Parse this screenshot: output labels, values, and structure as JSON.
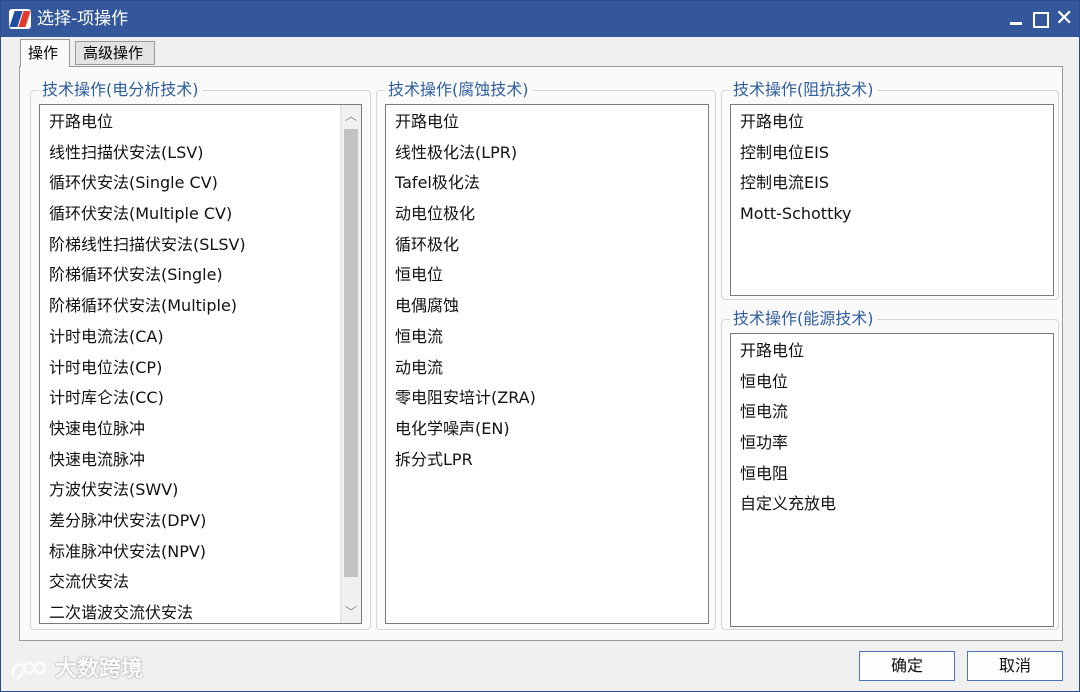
{
  "window": {
    "title": "选择-项操作"
  },
  "tabs": [
    {
      "label": "操作"
    },
    {
      "label": "高级操作"
    }
  ],
  "groups": {
    "electroanalysis": {
      "title": "技术操作(电分析技术)",
      "items": [
        "开路电位",
        "线性扫描伏安法(LSV)",
        "循环伏安法(Single CV)",
        "循环伏安法(Multiple CV)",
        "阶梯线性扫描伏安法(SLSV)",
        "阶梯循环伏安法(Single)",
        "阶梯循环伏安法(Multiple)",
        "计时电流法(CA)",
        "计时电位法(CP)",
        "计时库仑法(CC)",
        "快速电位脉冲",
        "快速电流脉冲",
        "方波伏安法(SWV)",
        "差分脉冲伏安法(DPV)",
        "标准脉冲伏安法(NPV)",
        "交流伏安法",
        "二次谐波交流伏安法"
      ]
    },
    "corrosion": {
      "title": "技术操作(腐蚀技术)",
      "items": [
        "开路电位",
        "线性极化法(LPR)",
        "Tafel极化法",
        "动电位极化",
        "循环极化",
        "恒电位",
        "电偶腐蚀",
        "恒电流",
        "动电流",
        "零电阻安培计(ZRA)",
        "电化学噪声(EN)",
        "拆分式LPR"
      ]
    },
    "impedance": {
      "title": "技术操作(阻抗技术)",
      "items": [
        "开路电位",
        "控制电位EIS",
        "控制电流EIS",
        "Mott-Schottky"
      ]
    },
    "energy": {
      "title": "技术操作(能源技术)",
      "items": [
        "开路电位",
        "恒电位",
        "恒电流",
        "恒功率",
        "恒电阻",
        "自定义充放电"
      ]
    }
  },
  "buttons": {
    "ok": "确定",
    "cancel": "取消"
  },
  "watermark": {
    "text": "大数跨境"
  },
  "colors": {
    "titlebar": "#33579a",
    "group_title": "#2e5e9e",
    "button_border": "#4a76b8"
  }
}
